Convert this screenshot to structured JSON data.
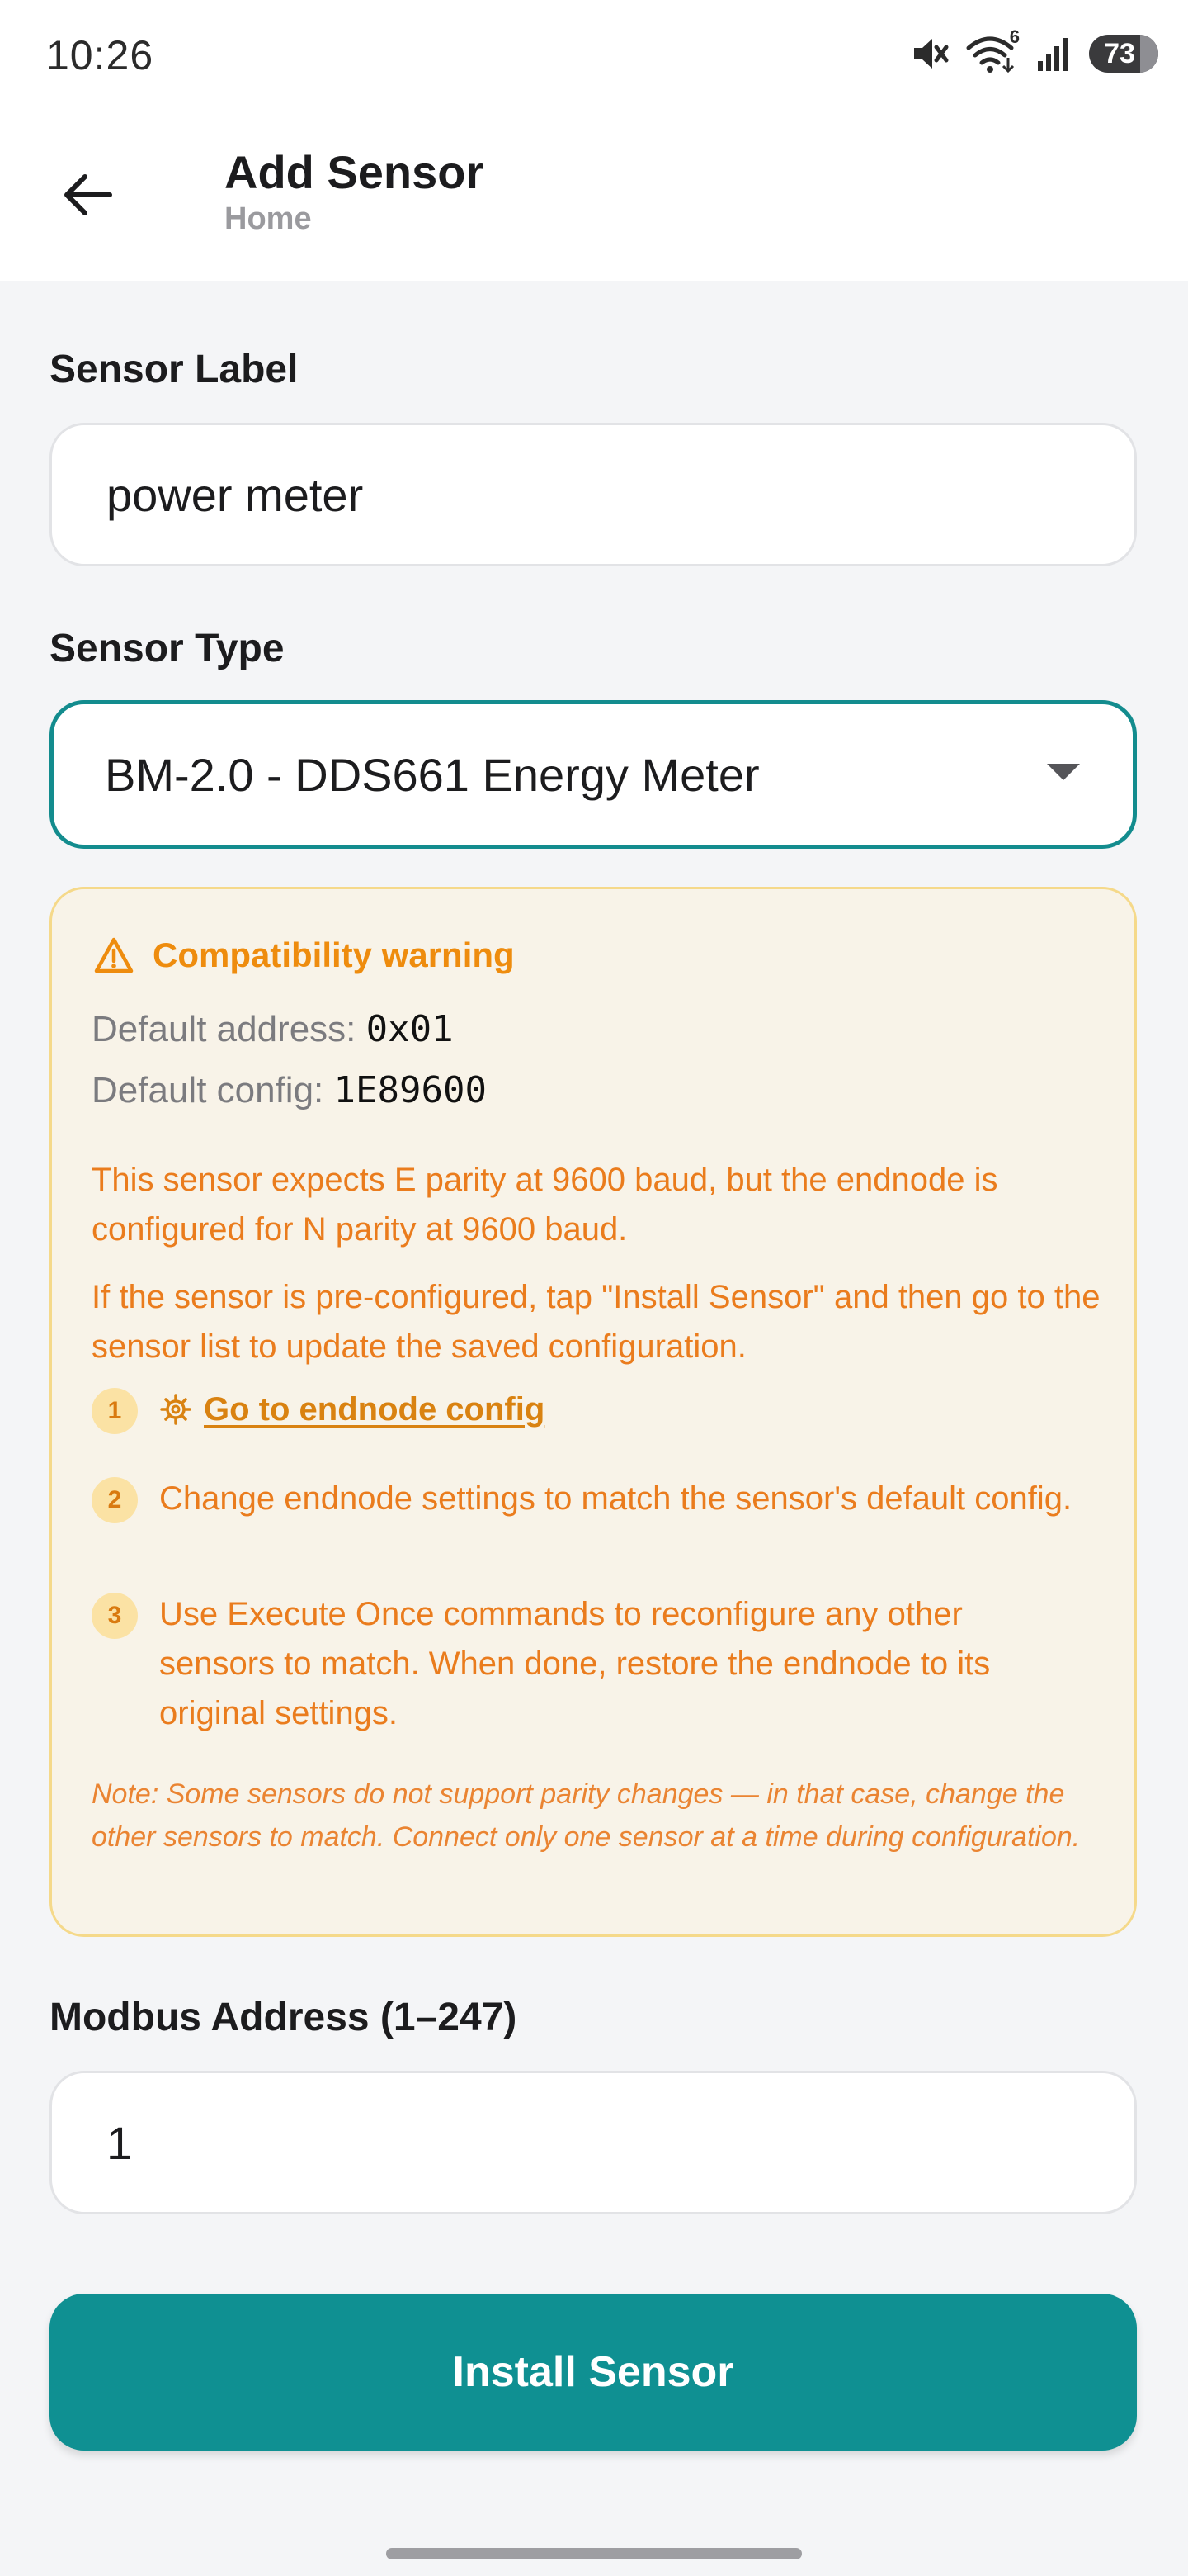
{
  "status_bar": {
    "time": "10:26",
    "battery": "73",
    "icons": [
      "mute-icon",
      "wifi-icon",
      "signal-icon",
      "battery-icon"
    ],
    "wifi_badge": "6"
  },
  "app_bar": {
    "title": "Add Sensor",
    "subtitle": "Home",
    "back_icon": "back-arrow-icon"
  },
  "form": {
    "label_field": {
      "label": "Sensor Label",
      "value": "power meter"
    },
    "type_field": {
      "label": "Sensor Type",
      "value": "BM-2.0 - DDS661 Energy Meter"
    },
    "address_field": {
      "label": "Modbus Address (1–247)",
      "value": "1"
    }
  },
  "warning": {
    "title": "Compatibility warning",
    "default_address_label": "Default address:",
    "default_address_value": "0x01",
    "default_config_label": "Default config:",
    "default_config_value": "1E89600",
    "paragraph_1": "This sensor expects E parity at 9600 baud, but the endnode is configured for N parity at 9600 baud.",
    "paragraph_2": "If the sensor is pre-configured, tap \"Install Sensor\" and then go to the sensor list to update the saved configuration.",
    "steps": [
      {
        "number": "1",
        "text": "Go to endnode config"
      },
      {
        "number": "2",
        "text": "Change endnode settings to match the sensor's default config."
      },
      {
        "number": "3",
        "text": "Use Execute Once commands to reconfigure any other sensors to match. When done, restore the endnode to its original settings."
      }
    ],
    "note": "Note: Some sensors do not support parity changes — in that case, change the other sensors to match. Connect only one sensor at a time during configuration."
  },
  "install_button": {
    "label": "Install Sensor"
  },
  "colors": {
    "accent": "#0f9092",
    "warning_text": "#ea7c1d",
    "warning_bg": "#f8f3e8",
    "warning_border": "#f5d98a"
  }
}
